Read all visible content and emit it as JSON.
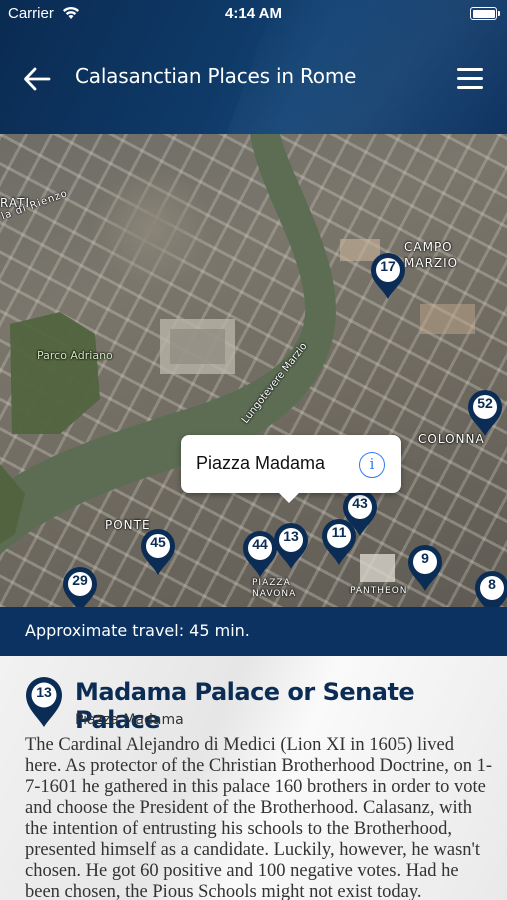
{
  "status_bar": {
    "carrier": "Carrier",
    "time": "4:14 AM"
  },
  "nav": {
    "title": "Calasanctian Places in Rome"
  },
  "map": {
    "labels": {
      "area1": "RATI",
      "street1": "la di Rienzo",
      "park": "Parco Adriano",
      "district_campo": "CAMPO",
      "district_marzio": "MARZIO",
      "street2": "Lungotevere Marzio",
      "district_colonna": "COLONNA",
      "district_ponte": "PONTE",
      "piazza": "PIAZZA",
      "navona": "NAVONA",
      "pantheon": "PANTHEON"
    },
    "pins": [
      "17",
      "52",
      "43",
      "45",
      "44",
      "13",
      "11",
      "9",
      "29",
      "8"
    ],
    "callout": {
      "place": "Piazza Madama"
    }
  },
  "travel": {
    "text": "Approximate travel: 45 min."
  },
  "detail": {
    "pin_number": "13",
    "title": "Madama Palace or Senate Palace",
    "subtitle": "Piazza Madama",
    "body": "The Cardinal Alejandro di Medici (Lion XI in 1605) lived here. As protector of the Christian Brotherhood Doctrine, on 1-7-1601 he gathered in this palace 160 brothers in order to vote and choose the President of the Brotherhood. Calasanz, with the intention of entrusting his schools to the Brotherhood, presented himself as a candidate. Luckily, however, he wasn't chosen. He got 60 positive and 100 negative votes. Had he been chosen, the Pious Schools might not exist today."
  },
  "colors": {
    "navy": "#0b2d55",
    "accent_blue": "#2f7cf6",
    "river": "#5c6d54"
  }
}
